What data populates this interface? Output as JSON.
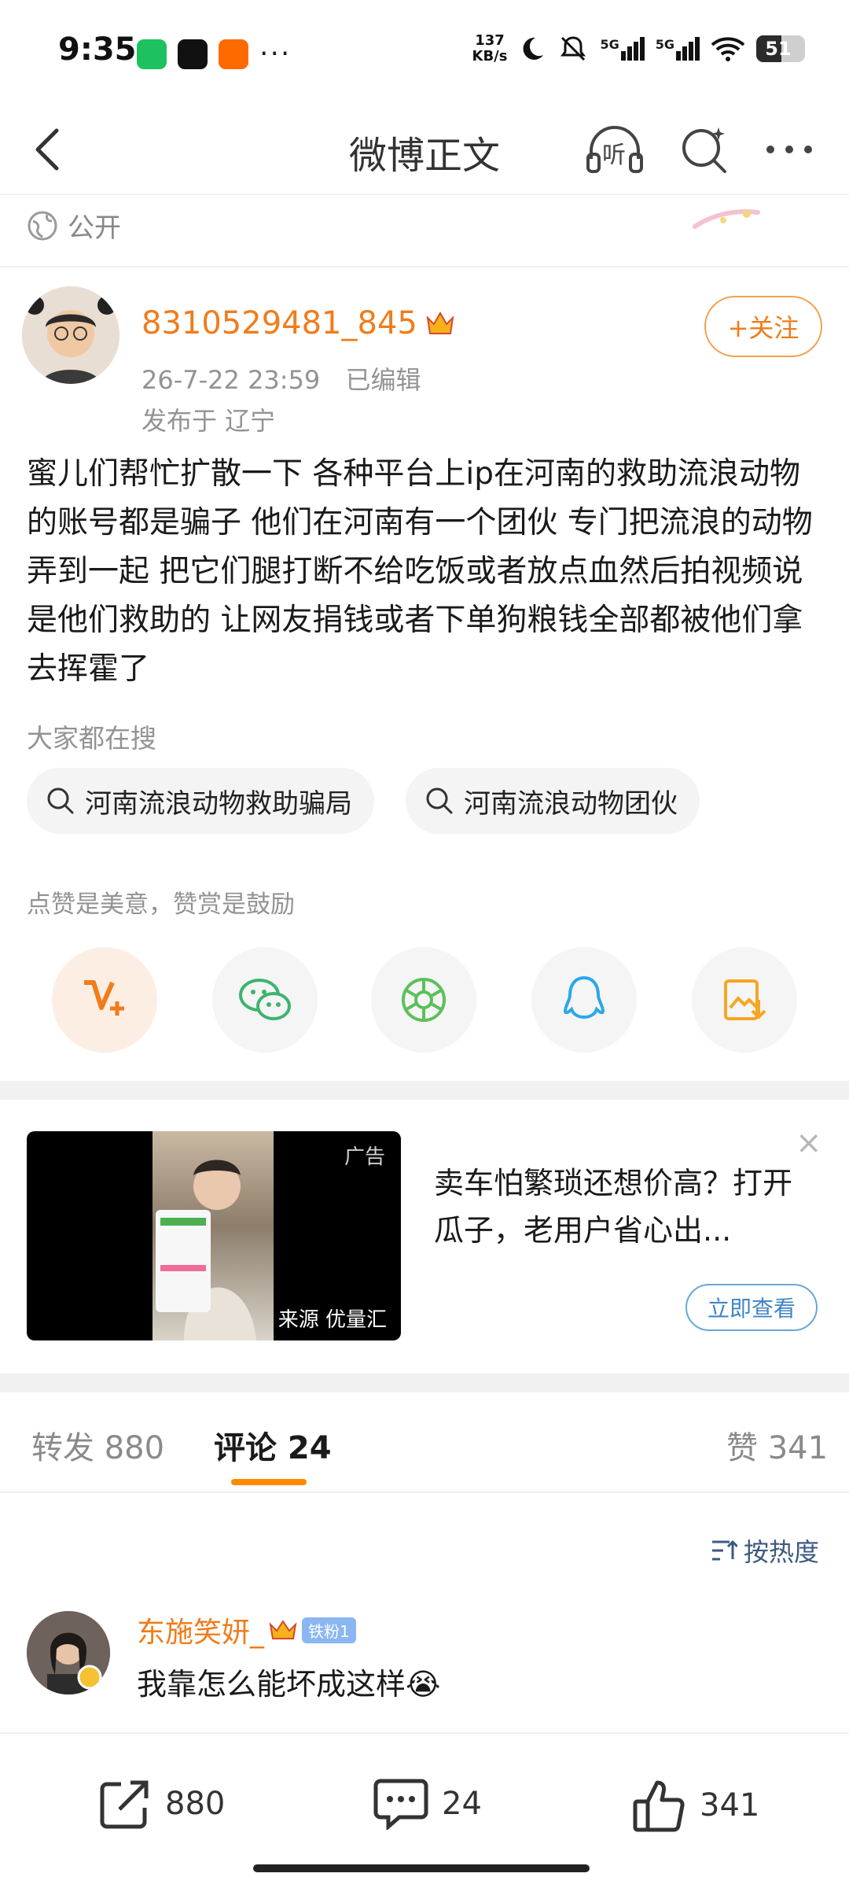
{
  "status_bar": {
    "time": "9:35",
    "dots": "···",
    "net_speed_value": "137",
    "net_speed_unit": "KB/s",
    "signal_1": "5G",
    "signal_2": "5G",
    "battery": "51",
    "battery_level": 0.51
  },
  "nav": {
    "title": "微博正文",
    "listen_label": "听"
  },
  "visibility": "公开",
  "author": {
    "name": "8310529481_845",
    "timestamp": "26-7-22 23:59",
    "edited": "已编辑",
    "location": "发布于 辽宁",
    "follow_label": "+关注"
  },
  "post": {
    "text": "蜜儿们帮忙扩散一下 各种平台上ip在河南的救助流浪动物的账号都是骗子 他们在河南有一个团伙 专门把流浪的动物弄到一起 把它们腿打断不给吃饭或者放点血然后拍视频说是他们救助的 让网友捐钱或者下单狗粮钱全部都被他们拿去挥霍了"
  },
  "searches": {
    "label": "大家都在搜",
    "items": [
      "河南流浪动物救助骗局",
      "河南流浪动物团伙"
    ]
  },
  "reward": {
    "label": "点赞是美意，赞赏是鼓励"
  },
  "share_icons": [
    "reward-v-icon",
    "wechat-icon",
    "moments-icon",
    "qq-icon",
    "save-image-icon"
  ],
  "ad": {
    "tag": "广告",
    "source": "来源 优量汇",
    "text": "卖车怕繁琐还想价高？打开瓜子，老用户省心出...",
    "cta": "立即查看",
    "close": "×"
  },
  "tabs": {
    "repost": "转发 880",
    "comments": "评论 24",
    "likes": "赞 341"
  },
  "sort": {
    "label": "按热度"
  },
  "comment": {
    "name": "东施笑妍_",
    "badge": "铁粉1",
    "text": "我靠怎么能坏成这样😭"
  },
  "bottom_bar": {
    "repost_count": "880",
    "comment_count": "24",
    "like_count": "341"
  },
  "colors": {
    "accent_orange": "#f07c1c",
    "link_blue": "#3f86c4",
    "gray_text": "#939393"
  }
}
